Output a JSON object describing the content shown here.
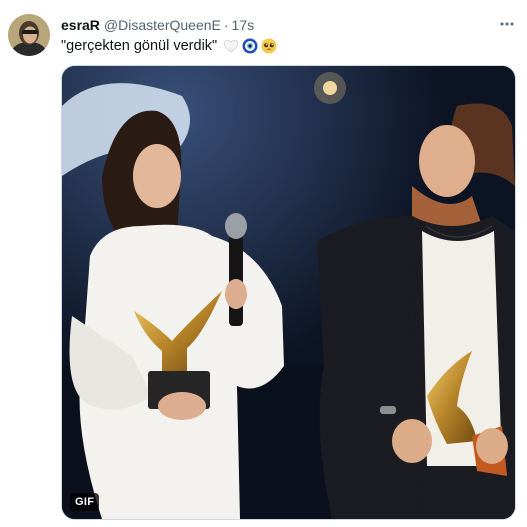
{
  "tweet": {
    "author_name": "esraR",
    "handle": "@DisasterQueenE",
    "separator": "·",
    "time": "17s",
    "text": "\"gerçekten gönül verdik\"",
    "emojis": [
      "white-heart-icon",
      "nazar-amulet-icon",
      "pleading-face-icon"
    ],
    "media": {
      "type": "gif",
      "badge": "GIF"
    }
  },
  "colors": {
    "name": "#0f1419",
    "secondary_text": "#536471",
    "border": "#cfd9de"
  }
}
